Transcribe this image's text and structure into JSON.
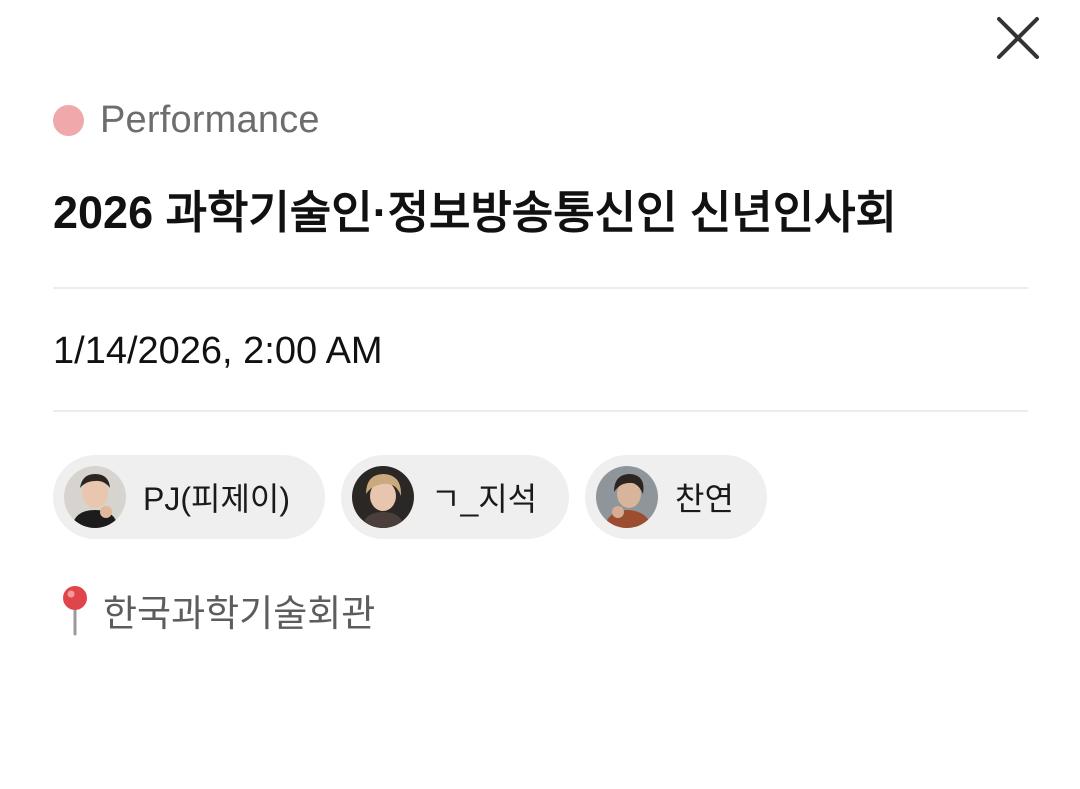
{
  "event": {
    "category": "Performance",
    "category_color": "#f0a8ab",
    "title": "2026 과학기술인·정보방송통신인 신년인사회",
    "datetime": "1/14/2026, 2:00 AM",
    "participants": [
      {
        "name": "PJ(피제이)",
        "avatar": "avatar-photo"
      },
      {
        "name": "ㄱ_지석",
        "avatar": "avatar-photo"
      },
      {
        "name": "찬연",
        "avatar": "avatar-photo"
      }
    ],
    "location": "한국과학기술회관",
    "location_icon": "pin-icon"
  },
  "controls": {
    "close_icon": "close-icon"
  }
}
